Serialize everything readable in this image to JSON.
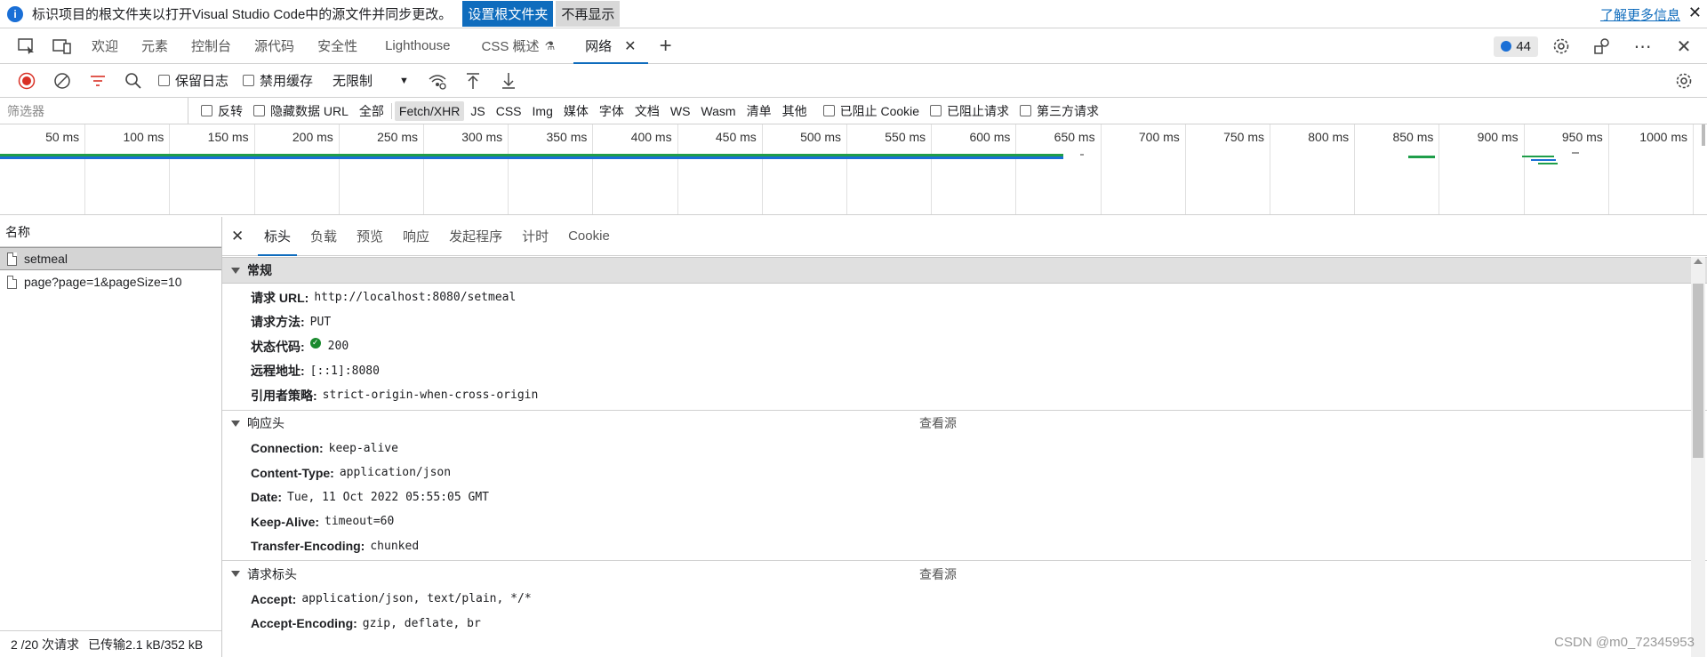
{
  "infobar": {
    "message": "标识项目的根文件夹以打开Visual Studio Code中的源文件并同步更改。",
    "set_root_button": "设置根文件夹",
    "dont_show_button": "不再显示",
    "learn_more_link": "了解更多信息"
  },
  "tabs": {
    "items": [
      {
        "label": "欢迎"
      },
      {
        "label": "元素"
      },
      {
        "label": "控制台"
      },
      {
        "label": "源代码"
      },
      {
        "label": "安全性"
      },
      {
        "label": "Lighthouse"
      },
      {
        "label": "CSS 概述"
      },
      {
        "label": "网络"
      }
    ],
    "issues_count": "44"
  },
  "toolbar": {
    "preserve_log": "保留日志",
    "disable_cache": "禁用缓存",
    "throttling": "无限制"
  },
  "filterbar": {
    "placeholder": "筛选器",
    "invert": "反转",
    "hide_data_urls": "隐藏数据 URL",
    "types": [
      "全部",
      "Fetch/XHR",
      "JS",
      "CSS",
      "Img",
      "媒体",
      "字体",
      "文档",
      "WS",
      "Wasm",
      "清单",
      "其他"
    ],
    "blocked_cookies": "已阻止 Cookie",
    "blocked_requests": "已阻止请求",
    "third_party": "第三方请求"
  },
  "timeline": {
    "ticks": [
      "50 ms",
      "100 ms",
      "150 ms",
      "200 ms",
      "250 ms",
      "300 ms",
      "350 ms",
      "400 ms",
      "450 ms",
      "500 ms",
      "550 ms",
      "600 ms",
      "650 ms",
      "700 ms",
      "750 ms",
      "800 ms",
      "850 ms",
      "900 ms",
      "950 ms",
      "1000 ms"
    ],
    "colors": {
      "waiting": "#1f9e4a",
      "download": "#1a6fd6"
    }
  },
  "requests": {
    "column_header": "名称",
    "items": [
      "setmeal",
      "page?page=1&pageSize=10"
    ],
    "status_count": "2 /20 次请求",
    "status_transferred": "已传输2.1 kB/352 kB"
  },
  "details": {
    "tabs": [
      "标头",
      "负载",
      "预览",
      "响应",
      "发起程序",
      "计时",
      "Cookie"
    ],
    "general": {
      "title": "常规",
      "rows": [
        {
          "k": "请求 URL:",
          "v": "http://localhost:8080/setmeal"
        },
        {
          "k": "请求方法:",
          "v": "PUT"
        },
        {
          "k": "状态代码:",
          "v": "200"
        },
        {
          "k": "远程地址:",
          "v": "[::1]:8080"
        },
        {
          "k": "引用者策略:",
          "v": "strict-origin-when-cross-origin"
        }
      ]
    },
    "response_headers": {
      "title": "响应头",
      "view_source": "查看源",
      "rows": [
        {
          "k": "Connection:",
          "v": "keep-alive"
        },
        {
          "k": "Content-Type:",
          "v": "application/json"
        },
        {
          "k": "Date:",
          "v": "Tue, 11 Oct 2022 05:55:05 GMT"
        },
        {
          "k": "Keep-Alive:",
          "v": "timeout=60"
        },
        {
          "k": "Transfer-Encoding:",
          "v": "chunked"
        }
      ]
    },
    "request_headers": {
      "title": "请求标头",
      "view_source": "查看源",
      "rows": [
        {
          "k": "Accept:",
          "v": "application/json, text/plain, */*"
        },
        {
          "k": "Accept-Encoding:",
          "v": "gzip, deflate, br"
        }
      ]
    }
  },
  "watermark": "CSDN @m0_72345953"
}
